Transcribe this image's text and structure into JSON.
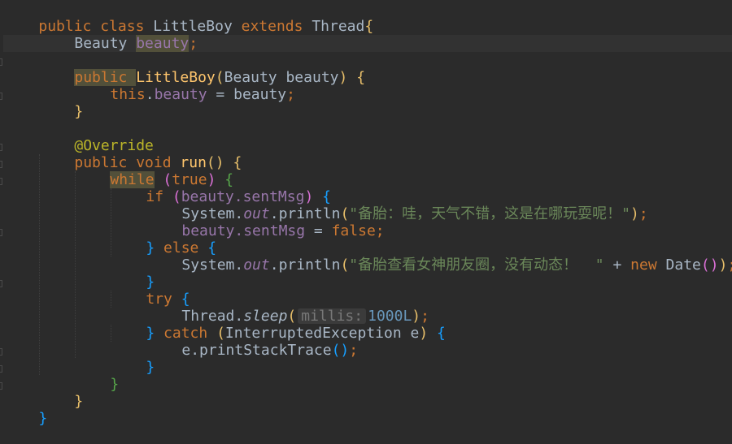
{
  "colors": {
    "background": "#2b2b2b",
    "keyword": "#cc7832",
    "method": "#ffc66d",
    "field": "#9876aa",
    "string": "#6a8759",
    "number": "#6897bb",
    "annotation": "#bbb529",
    "text": "#a9b7c6"
  },
  "code": {
    "l1": {
      "kw1": "public class ",
      "name": "LittleBoy ",
      "kw2": "extends ",
      "parent": "Thread",
      "brace": "{"
    },
    "l2": {
      "type": "Beauty ",
      "field": "beauty",
      "semi": ";"
    },
    "l4": {
      "kw": "public ",
      "name": "LittleBoy",
      "open": "(",
      "params": "Beauty beauty",
      "close": ") ",
      "brace": "{"
    },
    "l5": {
      "kw": "this",
      "dot": ".",
      "field": "beauty",
      "assign": " = beauty",
      "semi": ";"
    },
    "l6": {
      "brace": "}"
    },
    "l8": {
      "ann": "@Override"
    },
    "l9": {
      "kw": "public void ",
      "name": "run",
      "parens": "() ",
      "brace": "{"
    },
    "l10": {
      "kw": "while",
      "sp": " ",
      "open": "(",
      "kw2": "true",
      "close": ") ",
      "brace": "{"
    },
    "l11": {
      "kw": "if ",
      "open": "(",
      "obj": "beauty.",
      "field": "sentMsg",
      "close": ") ",
      "brace": "{"
    },
    "l12": {
      "sys": "System.",
      "out": "out",
      "call": ".println",
      "open": "(",
      "str": "\"备胎：哇，天气不错，这是在哪玩耍呢！\"",
      "close": ")",
      "semi": ";"
    },
    "l13": {
      "obj": "beauty.",
      "field": "sentMsg",
      "assign": " = ",
      "kw": "false",
      "semi": ";"
    },
    "l14": {
      "brace1": "} ",
      "kw": "else ",
      "brace2": "{"
    },
    "l15": {
      "sys": "System.",
      "out": "out",
      "call": ".println",
      "open": "(",
      "str": "\"备胎查看女神朋友圈，没有动态！  \"",
      "plus": " + ",
      "kw": "new ",
      "cls": "Date",
      "p1": "()",
      "close": ")",
      "semi": ";"
    },
    "l16": {
      "brace": "}"
    },
    "l17": {
      "kw": "try ",
      "brace": "{"
    },
    "l18": {
      "cls": "Thread.",
      "fn": "sleep",
      "open": "(",
      "hint": "millis:",
      "num": "1000L",
      "close": ")",
      "semi": ";"
    },
    "l19": {
      "brace1": "} ",
      "kw": "catch ",
      "open": "(",
      "ex": "InterruptedException e",
      "close": ") ",
      "brace2": "{"
    },
    "l20": {
      "call": "e.printStackTrace",
      "parens": "()",
      "semi": ";"
    },
    "l21": {
      "brace": "}"
    },
    "l22": {
      "brace": "}"
    },
    "l23": {
      "brace": "}"
    },
    "l24": {
      "brace": "}"
    }
  }
}
